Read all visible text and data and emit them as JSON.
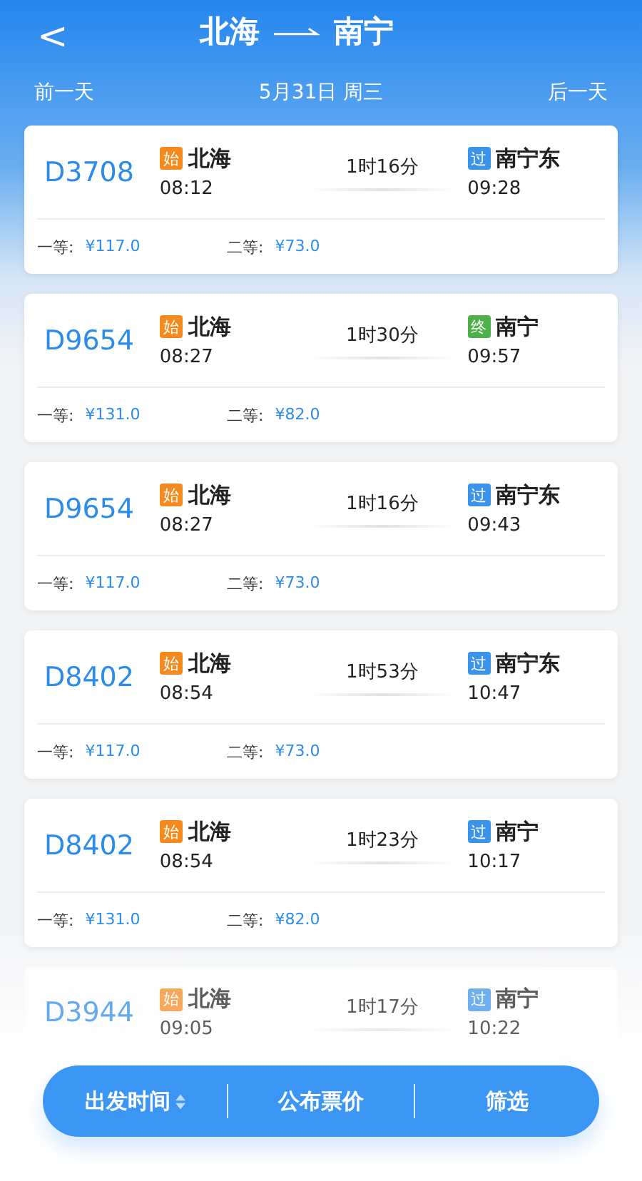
{
  "header": {
    "back": "<",
    "origin": "北海",
    "destination": "南宁",
    "prev_day": "前一天",
    "date": "5月31日 周三",
    "next_day": "后一天"
  },
  "trains": [
    {
      "number": "D3708",
      "dep": {
        "badge": "始",
        "kind": "start",
        "station": "北海",
        "time": "08:12"
      },
      "duration": "1时16分",
      "arr": {
        "badge": "过",
        "kind": "pass",
        "station": "南宁东",
        "time": "09:28"
      },
      "prices": [
        {
          "label": "一等:",
          "price": "¥117.0"
        },
        {
          "label": "二等:",
          "price": "¥73.0"
        }
      ]
    },
    {
      "number": "D9654",
      "dep": {
        "badge": "始",
        "kind": "start",
        "station": "北海",
        "time": "08:27"
      },
      "duration": "1时30分",
      "arr": {
        "badge": "终",
        "kind": "end",
        "station": "南宁",
        "time": "09:57"
      },
      "prices": [
        {
          "label": "一等:",
          "price": "¥131.0"
        },
        {
          "label": "二等:",
          "price": "¥82.0"
        }
      ]
    },
    {
      "number": "D9654",
      "dep": {
        "badge": "始",
        "kind": "start",
        "station": "北海",
        "time": "08:27"
      },
      "duration": "1时16分",
      "arr": {
        "badge": "过",
        "kind": "pass",
        "station": "南宁东",
        "time": "09:43"
      },
      "prices": [
        {
          "label": "一等:",
          "price": "¥117.0"
        },
        {
          "label": "二等:",
          "price": "¥73.0"
        }
      ]
    },
    {
      "number": "D8402",
      "dep": {
        "badge": "始",
        "kind": "start",
        "station": "北海",
        "time": "08:54"
      },
      "duration": "1时53分",
      "arr": {
        "badge": "过",
        "kind": "pass",
        "station": "南宁东",
        "time": "10:47"
      },
      "prices": [
        {
          "label": "一等:",
          "price": "¥117.0"
        },
        {
          "label": "二等:",
          "price": "¥73.0"
        }
      ]
    },
    {
      "number": "D8402",
      "dep": {
        "badge": "始",
        "kind": "start",
        "station": "北海",
        "time": "08:54"
      },
      "duration": "1时23分",
      "arr": {
        "badge": "过",
        "kind": "pass",
        "station": "南宁",
        "time": "10:17"
      },
      "prices": [
        {
          "label": "一等:",
          "price": "¥131.0"
        },
        {
          "label": "二等:",
          "price": "¥82.0"
        }
      ]
    },
    {
      "number": "D3944",
      "dep": {
        "badge": "始",
        "kind": "start",
        "station": "北海",
        "time": "09:05"
      },
      "duration": "1时17分",
      "arr": {
        "badge": "过",
        "kind": "pass",
        "station": "南宁",
        "time": "10:22"
      }
    }
  ],
  "bottom_bar": [
    {
      "label": "出发时间",
      "sortable": true
    },
    {
      "label": "公布票价",
      "sortable": false
    },
    {
      "label": "筛选",
      "sortable": false
    }
  ]
}
